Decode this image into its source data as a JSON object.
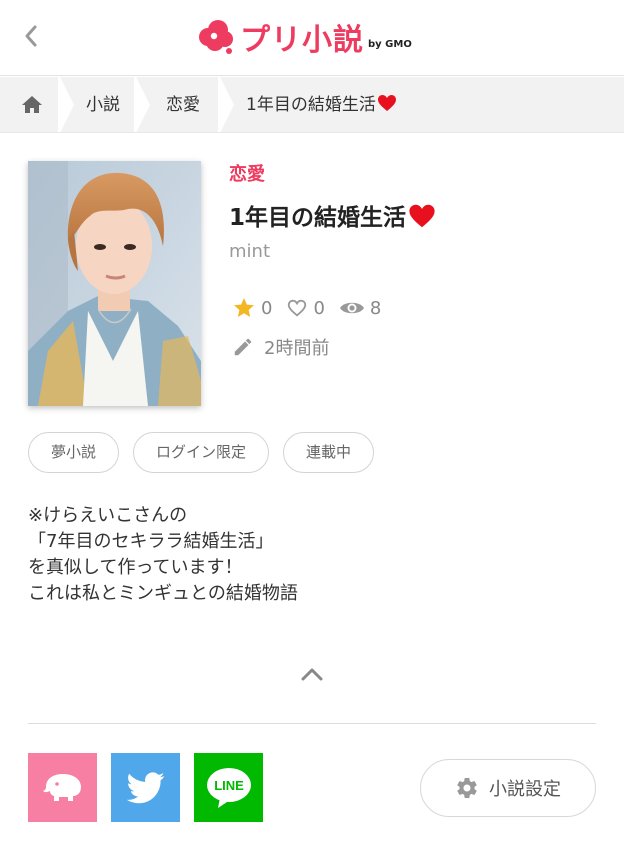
{
  "header": {
    "logo_text": "プリ小説",
    "logo_by": "by GMO"
  },
  "breadcrumb": {
    "items": [
      "小説",
      "恋愛",
      "1年目の結婚生活"
    ]
  },
  "novel": {
    "genre": "恋愛",
    "title": "1年目の結婚生活",
    "author": "mint",
    "stars": "0",
    "likes": "0",
    "views": "8",
    "updated": "2時間前"
  },
  "tags": [
    "夢小説",
    "ログイン限定",
    "連載中"
  ],
  "description": {
    "lines": [
      "※けらえいこさんの",
      "「7年目のセキララ結婚生活」",
      "を真似して作っています！",
      "",
      "これは私とミンギュとの結婚物語"
    ]
  },
  "actions": {
    "settings_label": "小説設定"
  },
  "colors": {
    "brand": "#ee3b60",
    "puri_share": "#f77fa3",
    "twitter": "#50a8ea",
    "line": "#00b900",
    "star": "#f5b623",
    "heart": "#e8101f"
  }
}
